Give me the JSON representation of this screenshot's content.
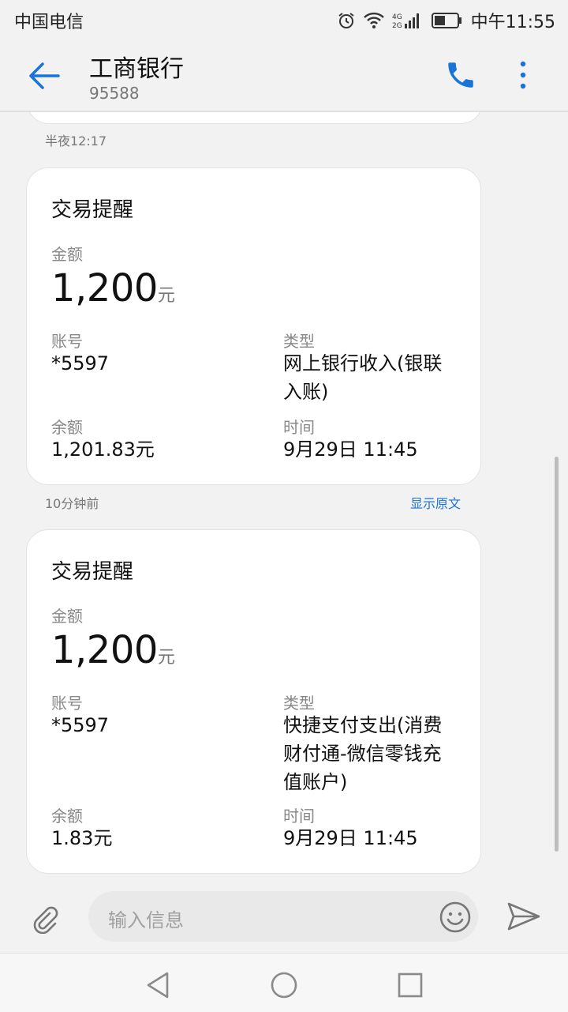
{
  "status_bar": {
    "carrier": "中国电信",
    "network": "4G 2G",
    "time": "中午11:55",
    "icons": [
      "alarm-icon",
      "wifi-icon",
      "signal-icon",
      "battery-icon"
    ]
  },
  "header": {
    "title": "工商银行",
    "number": "95588",
    "icons": [
      "back-arrow-icon",
      "phone-icon",
      "more-vert-icon"
    ],
    "accent_color": "#1a74d8"
  },
  "prev_message_time": "半夜12:17",
  "messages": [
    {
      "title": "交易提醒",
      "amount_label": "金额",
      "amount": "1,200",
      "amount_unit": "元",
      "account_label": "账号",
      "account": "*5597",
      "type_label": "类型",
      "type_lines": [
        "网上银行收入(银联",
        "入账)"
      ],
      "balance_label": "余额",
      "balance": "1,201.83元",
      "time_label": "时间",
      "time": "9月29日 11:45",
      "footer_time": "10分钟前",
      "footer_link": "显示原文"
    },
    {
      "title": "交易提醒",
      "amount_label": "金额",
      "amount": "1,200",
      "amount_unit": "元",
      "account_label": "账号",
      "account": "*5597",
      "type_label": "类型",
      "type_lines": [
        "快捷支付支出(消费",
        "财付通-微信零钱充",
        "值账户)"
      ],
      "balance_label": "余额",
      "balance": "1.83元",
      "time_label": "时间",
      "time": "9月29日 11:45"
    }
  ],
  "composer": {
    "placeholder": "输入信息",
    "icons": [
      "attachment-icon",
      "emoji-icon",
      "send-icon"
    ]
  },
  "navigation": {
    "icons": [
      "nav-back-icon",
      "nav-home-icon",
      "nav-recents-icon"
    ]
  }
}
